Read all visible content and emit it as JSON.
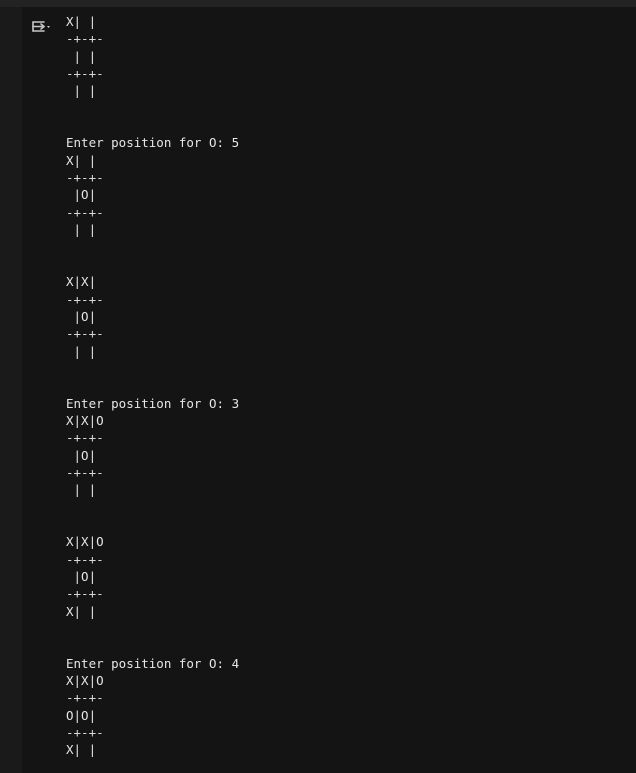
{
  "icons": {
    "output_toggle": "output-options-icon"
  },
  "colors": {
    "background": "#151515",
    "text": "#e6e6e6",
    "gutter": "#1a1a1a"
  },
  "output_lines": [
    "X| |",
    "-+-+-",
    " | |",
    "-+-+-",
    " | |",
    "",
    "",
    "Enter position for O: 5",
    "X| |",
    "-+-+-",
    " |O|",
    "-+-+-",
    " | |",
    "",
    "",
    "X|X|",
    "-+-+-",
    " |O|",
    "-+-+-",
    " | |",
    "",
    "",
    "Enter position for O: 3",
    "X|X|O",
    "-+-+-",
    " |O|",
    "-+-+-",
    " | |",
    "",
    "",
    "X|X|O",
    "-+-+-",
    " |O|",
    "-+-+-",
    "X| |",
    "",
    "",
    "Enter position for O: 4",
    "X|X|O",
    "-+-+-",
    "O|O|",
    "-+-+-",
    "X| |"
  ]
}
